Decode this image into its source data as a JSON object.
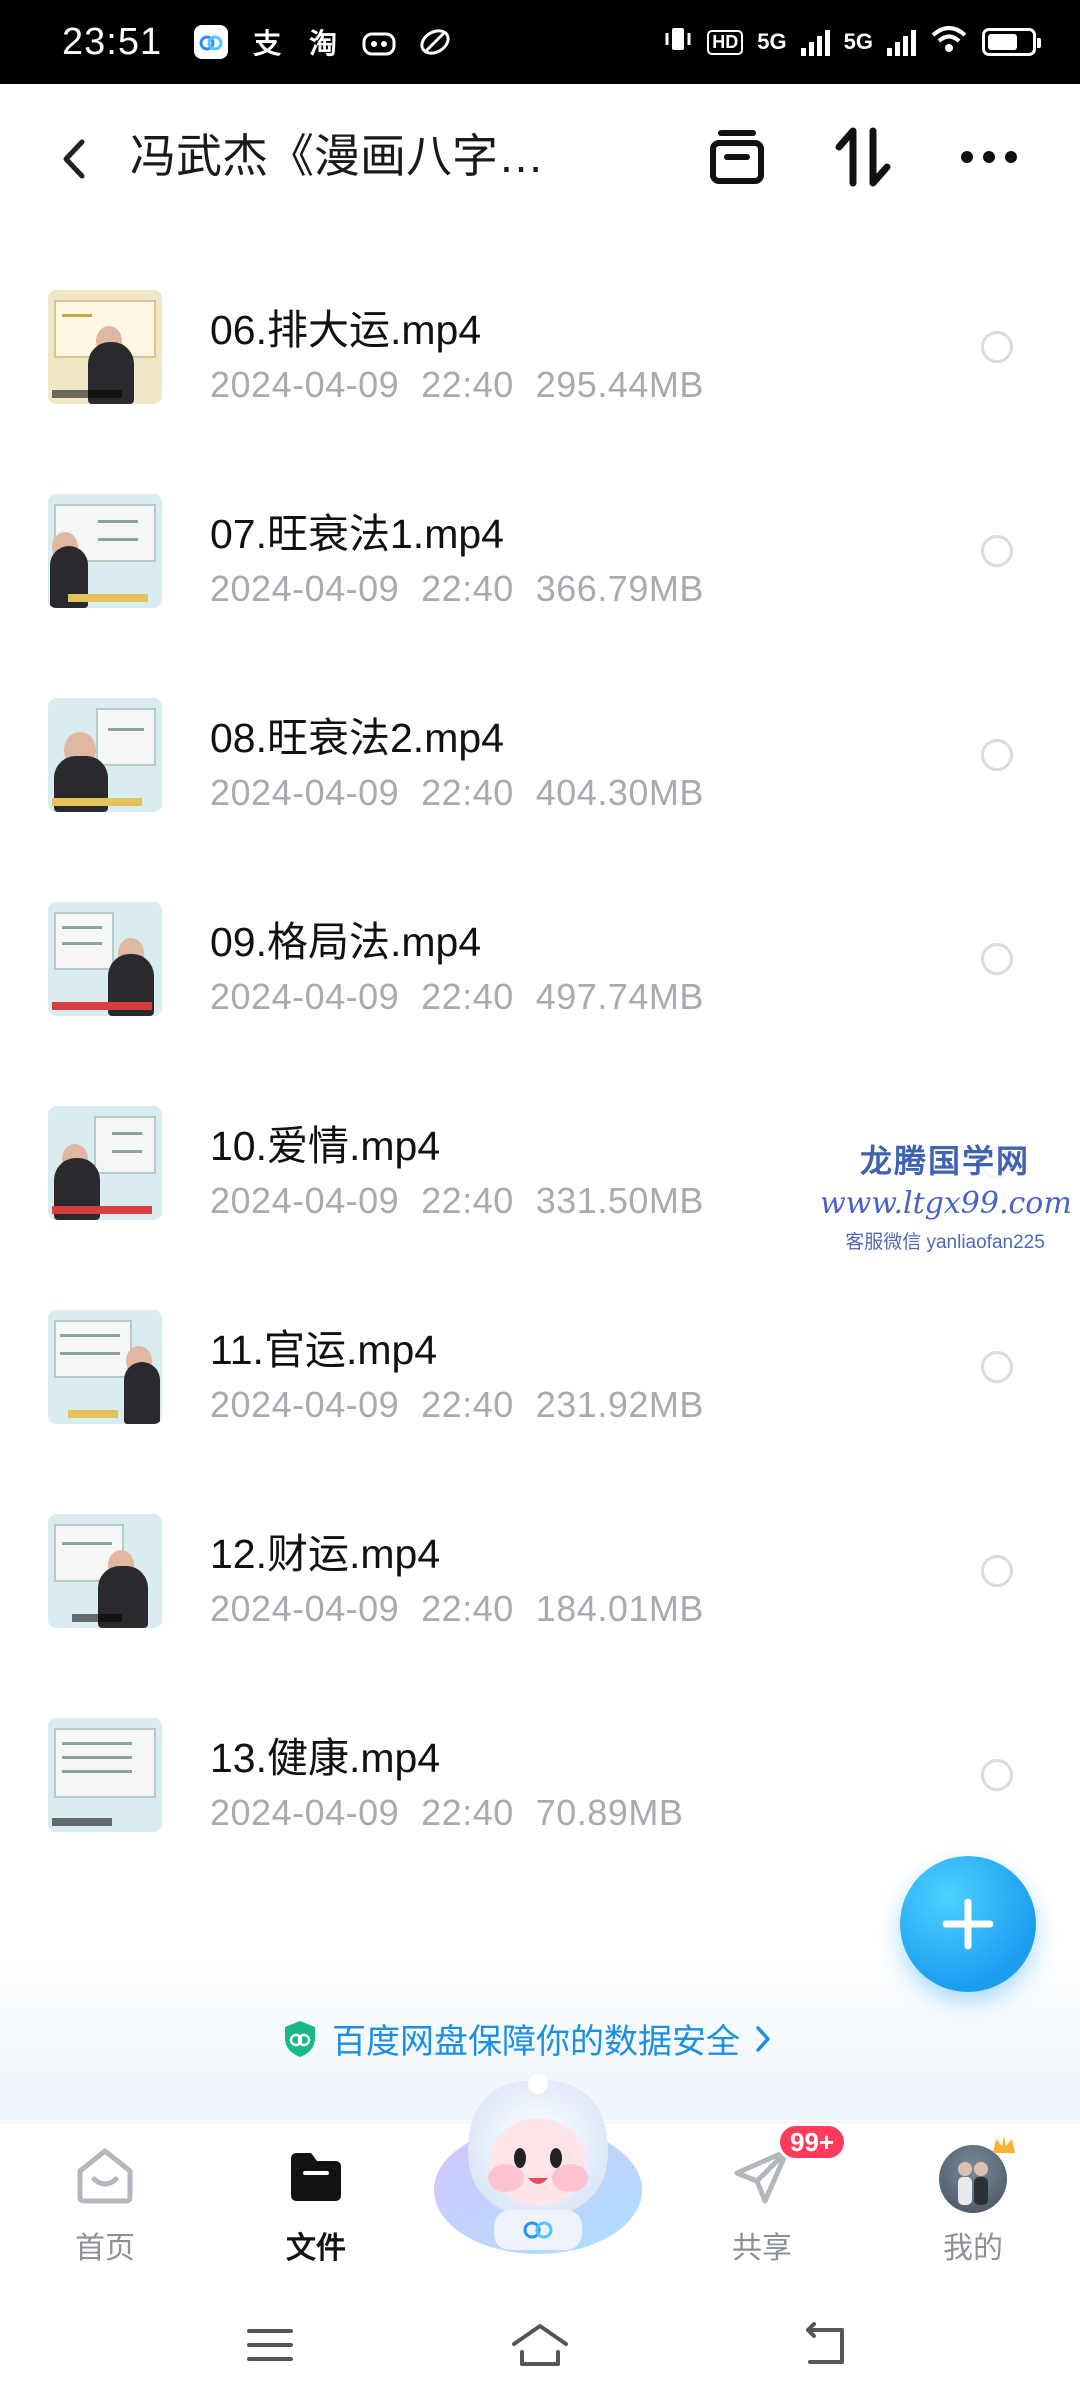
{
  "status_bar": {
    "time": "23:51",
    "apps": [
      "支",
      "淘"
    ],
    "hd": "HD",
    "net1": "5G",
    "net2": "5G"
  },
  "header": {
    "title": "冯武杰《漫画八字…",
    "icons": [
      "back-icon",
      "select-icon",
      "sort-icon",
      "more-icon"
    ]
  },
  "files": [
    {
      "name": "06.排大运.mp4",
      "date": "2024-04-09",
      "time": "22:40",
      "size": "295.44MB"
    },
    {
      "name": "07.旺衰法1.mp4",
      "date": "2024-04-09",
      "time": "22:40",
      "size": "366.79MB"
    },
    {
      "name": "08.旺衰法2.mp4",
      "date": "2024-04-09",
      "time": "22:40",
      "size": "404.30MB"
    },
    {
      "name": "09.格局法.mp4",
      "date": "2024-04-09",
      "time": "22:40",
      "size": "497.74MB"
    },
    {
      "name": "10.爱情.mp4",
      "date": "2024-04-09",
      "time": "22:40",
      "size": "331.50MB"
    },
    {
      "name": "11.官运.mp4",
      "date": "2024-04-09",
      "time": "22:40",
      "size": "231.92MB"
    },
    {
      "name": "12.财运.mp4",
      "date": "2024-04-09",
      "time": "22:40",
      "size": "184.01MB"
    },
    {
      "name": "13.健康.mp4",
      "date": "2024-04-09",
      "time": "22:40",
      "size": "70.89MB"
    }
  ],
  "watermark": {
    "title": "龙腾国学网",
    "url": "www.ltgx99.com",
    "wechat": "客服微信 yanliaofan225"
  },
  "security": {
    "text": "百度网盘保障你的数据安全"
  },
  "bottom_nav": {
    "home": "首页",
    "files": "文件",
    "share": "共享",
    "share_badge": "99+",
    "mine": "我的"
  },
  "colors": {
    "accent": "#1b9ef0",
    "badge": "#ff3b5c",
    "meta_text": "#a7abb1"
  }
}
